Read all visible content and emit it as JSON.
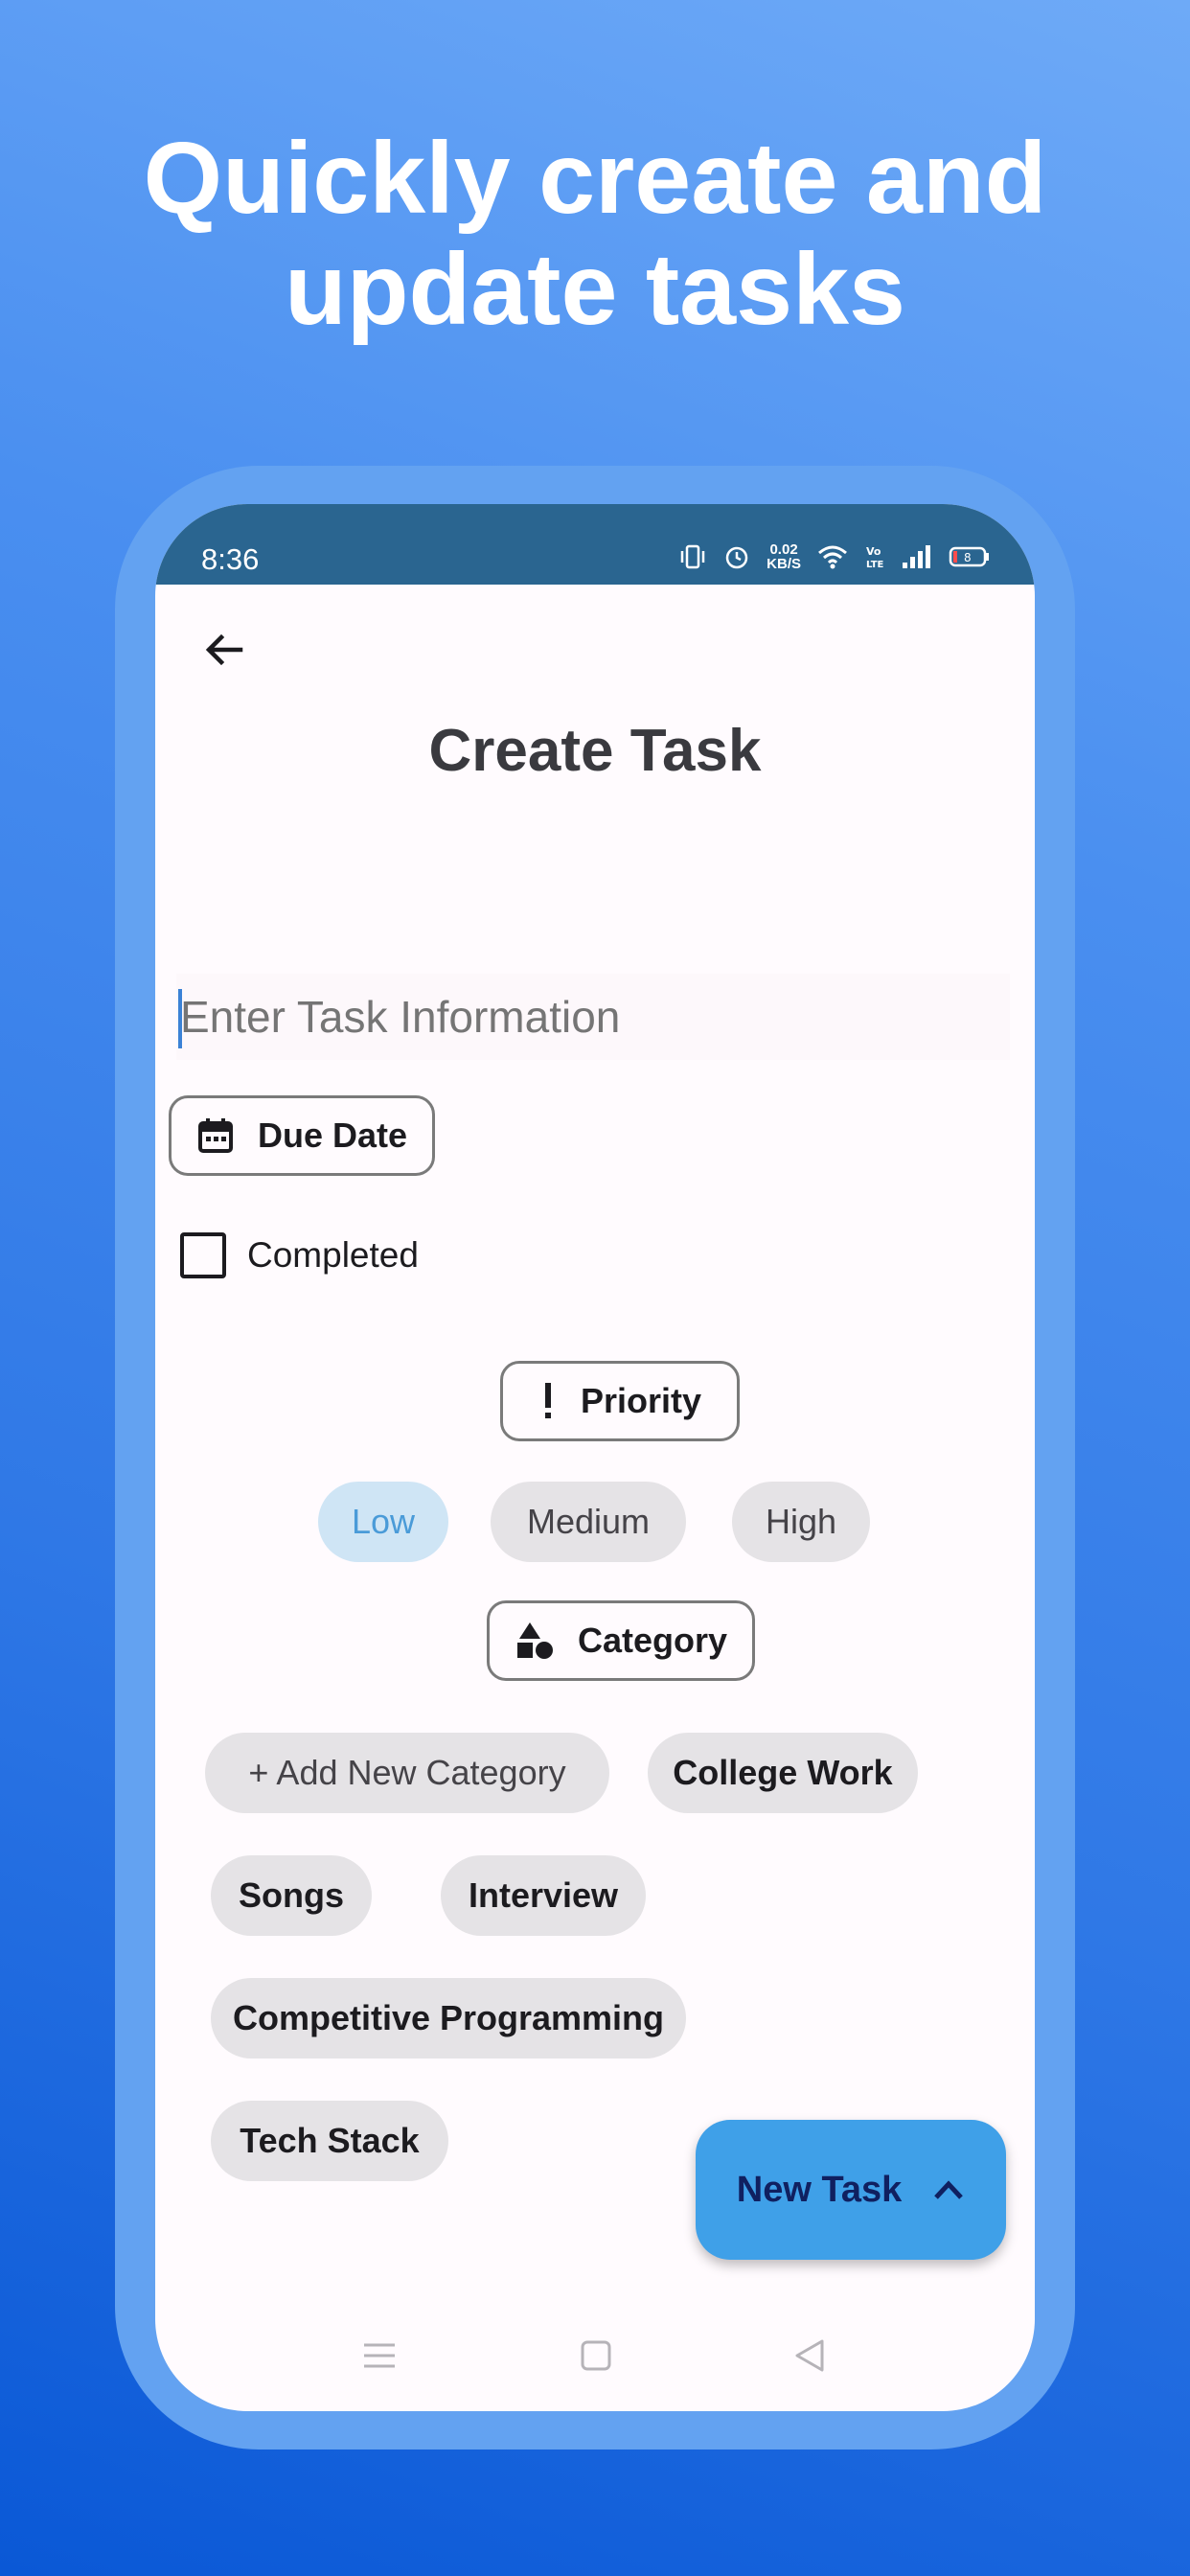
{
  "headline": {
    "line1": "Quickly create and",
    "line2": "update tasks"
  },
  "statusbar": {
    "time": "8:36",
    "net_speed_value": "0.02",
    "net_speed_unit": "KB/S",
    "battery": "8"
  },
  "header": {
    "title": "Create Task"
  },
  "task_input": {
    "placeholder": "Enter Task Information",
    "value": ""
  },
  "due_date": {
    "label": "Due Date"
  },
  "completed": {
    "label": "Completed",
    "checked": false
  },
  "priority": {
    "label": "Priority",
    "options": [
      "Low",
      "Medium",
      "High"
    ],
    "selected": "Low"
  },
  "category": {
    "label": "Category",
    "add_label": "+ Add New Category",
    "items": [
      "College Work",
      "Songs",
      "Interview",
      "Competitive Programming",
      "Tech Stack"
    ]
  },
  "fab": {
    "label": "New Task"
  },
  "colors": {
    "accent": "#3fa0e8",
    "statusbar": "#2a6590",
    "selected_chip": "#cfe5f5",
    "chip": "#e5e3e6"
  }
}
